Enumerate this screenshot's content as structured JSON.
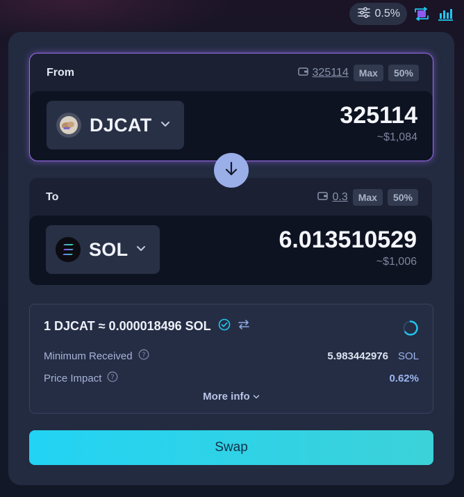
{
  "topbar": {
    "slippage": "0.5%",
    "icons": {
      "settings": "sliders-icon",
      "mode": "swap-mode-icon",
      "chart": "bar-chart-icon"
    },
    "colors": {
      "accent": "#22c6f0"
    }
  },
  "from": {
    "label": "From",
    "balance": "325114",
    "max_label": "Max",
    "half_label": "50%",
    "token": "DJCAT",
    "amount": "325114",
    "usd": "~$1,084"
  },
  "to": {
    "label": "To",
    "balance": "0.3",
    "max_label": "Max",
    "half_label": "50%",
    "token": "SOL",
    "amount": "6.013510529",
    "usd": "~$1,006"
  },
  "info": {
    "rate": "1 DJCAT ≈ 0.000018496 SOL",
    "min_received_label": "Minimum Received",
    "min_received_value": "5.983442976",
    "min_received_unit": "SOL",
    "price_impact_label": "Price Impact",
    "price_impact_value": "0.62%",
    "more_info": "More info"
  },
  "swap": {
    "label": "Swap"
  },
  "colors": {
    "from_border": "#9b6cf0",
    "swap_gradient_start": "#22d3f4",
    "swap_gradient_end": "#3cd2d9",
    "direction_button": "#9aaee8"
  }
}
